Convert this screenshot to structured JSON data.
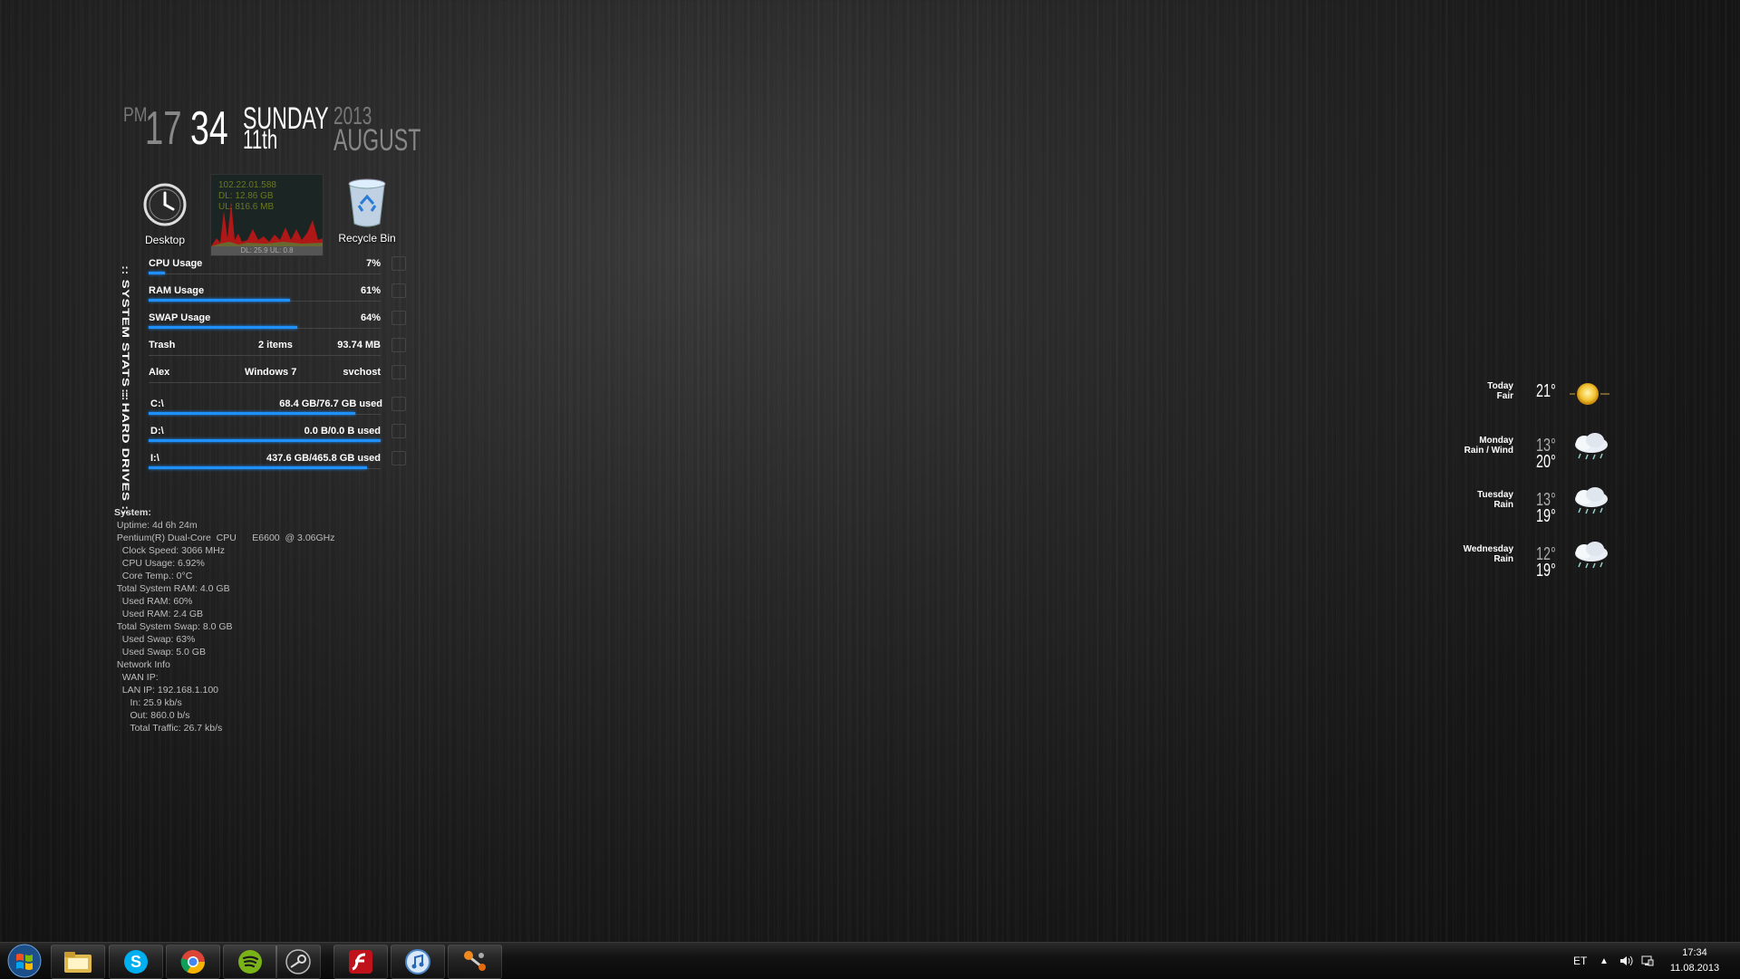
{
  "clock": {
    "ampm": "PM",
    "hour": "17",
    "minute": "34",
    "day": "SUNDAY",
    "date": "11th",
    "year": "2013",
    "month": "AUGUST"
  },
  "desktop_icons": [
    {
      "label": "Desktop",
      "icon": "clock-icon"
    },
    {
      "label": "Recycle Bin",
      "icon": "recycle-bin-icon"
    }
  ],
  "net_graph": {
    "lines": [
      "102.22.01.588",
      "DL: 12.86 GB",
      "UL: 816.6 MB"
    ],
    "footer": "DL: 25.9  UL: 0.8"
  },
  "labels": {
    "system_stats": ":: SYSTEM STATS ::",
    "hard_drives": ":: HARD DRIVES ::"
  },
  "stats": {
    "cpu": {
      "label": "CPU Usage",
      "value": "7%",
      "percent": 7
    },
    "ram": {
      "label": "RAM Usage",
      "value": "61%",
      "percent": 61
    },
    "swap": {
      "label": "SWAP Usage",
      "value": "64%",
      "percent": 64
    },
    "trash": {
      "label": "Trash",
      "items": "2 items",
      "size": "93.74 MB"
    },
    "user": {
      "name": "Alex",
      "os": "Windows 7",
      "process": "svchost"
    }
  },
  "drives": [
    {
      "label": "C:\\",
      "usage": "68.4 GB/76.7 GB used",
      "percent": 89
    },
    {
      "label": "D:\\",
      "usage": "0.0 B/0.0 B used",
      "percent": 100
    },
    {
      "label": "I:\\",
      "usage": "437.6 GB/465.8 GB used",
      "percent": 94
    }
  ],
  "sysinfo": [
    "System:",
    " Uptime: 4d 6h 24m",
    " Pentium(R) Dual-Core  CPU      E6600  @ 3.06GHz",
    "   Clock Speed: 3066 MHz",
    "   CPU Usage: 6.92%",
    "   Core Temp.: 0°C",
    " Total System RAM: 4.0 GB",
    "   Used RAM: 60%",
    "   Used RAM: 2.4 GB",
    " Total System Swap: 8.0 GB",
    "   Used Swap: 63%",
    "   Used Swap: 5.0 GB",
    " Network Info",
    "   WAN IP:",
    "   LAN IP: 192.168.1.100",
    "      In: 25.9 kb/s",
    "      Out: 860.0 b/s",
    "      Total Traffic: 26.7 kb/s"
  ],
  "weather": [
    {
      "day": "Today",
      "cond": "Fair",
      "high": "21°",
      "low": "",
      "icon": "sun-icon"
    },
    {
      "day": "Monday",
      "cond": "Rain / Wind",
      "high": "13°",
      "low": "20°",
      "icon": "rain-cloud-icon"
    },
    {
      "day": "Tuesday",
      "cond": "Rain",
      "high": "13°",
      "low": "19°",
      "icon": "rain-cloud-icon"
    },
    {
      "day": "Wednesday",
      "cond": "Rain",
      "high": "12°",
      "low": "19°",
      "icon": "rain-cloud-icon"
    }
  ],
  "taskbar": {
    "apps": [
      "windows-explorer-icon",
      "skype-icon",
      "chrome-icon",
      "spotify-icon",
      "steam-icon",
      "flash-icon",
      "itunes-icon",
      "connector-app-icon"
    ],
    "language": "ET",
    "time": "17:34",
    "date": "11.08.2013"
  },
  "colors": {
    "bar_accent": "#1e90ff",
    "background": "#1c1c1c"
  }
}
